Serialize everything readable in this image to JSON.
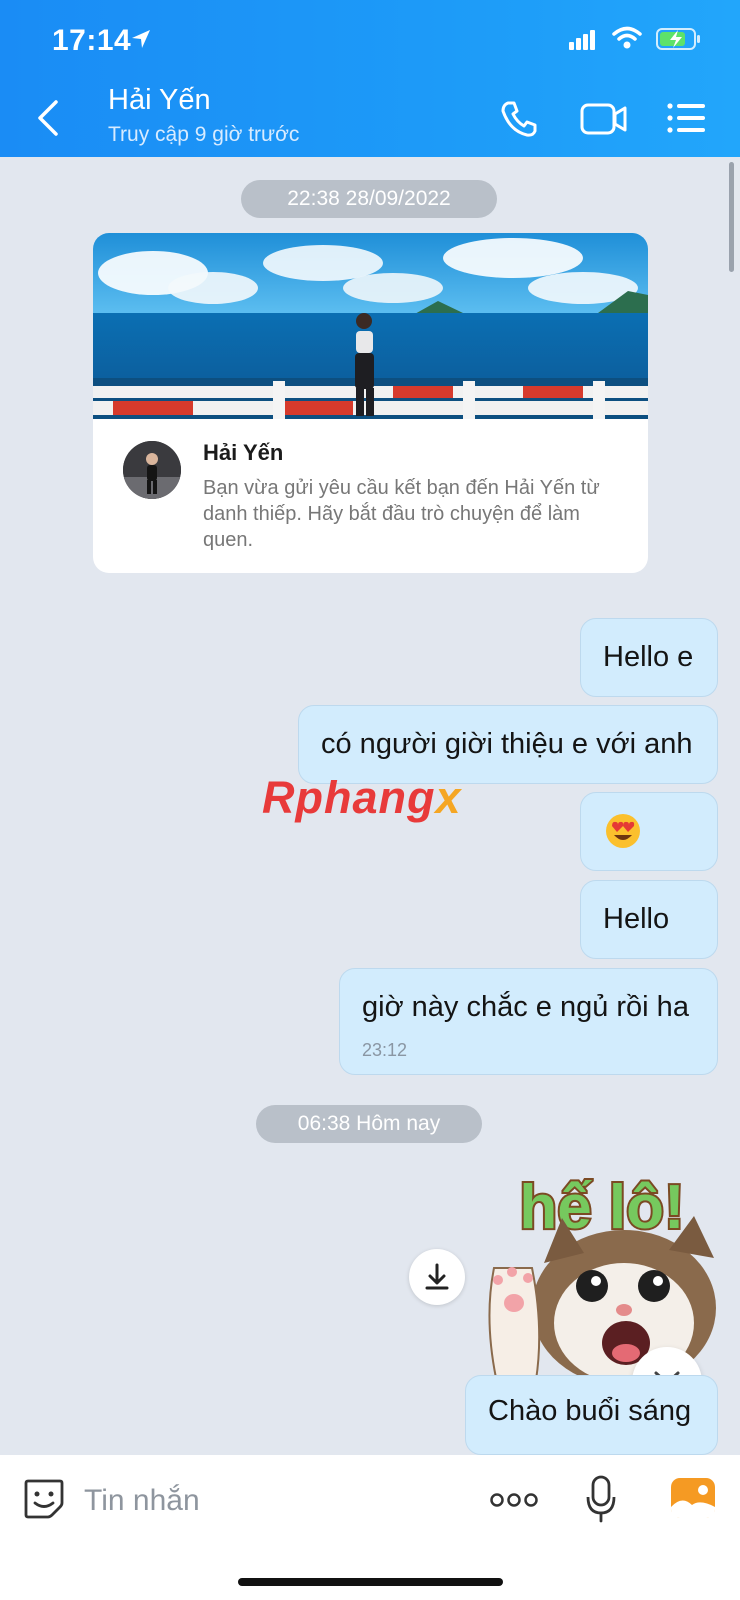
{
  "status_bar": {
    "time": "17:14"
  },
  "header": {
    "contact_name": "Hải Yến",
    "contact_status": "Truy cập 9 giờ trước",
    "icons": [
      "back-icon",
      "call-icon",
      "video-call-icon",
      "menu-icon"
    ]
  },
  "chat": {
    "date_divider_1": "22:38 28/09/2022",
    "friend_card": {
      "name": "Hải Yến",
      "text": "Bạn vừa gửi yêu cầu kết bạn đến Hải Yến từ danh thiếp. Hãy bắt đầu trò chuyện để làm quen."
    },
    "messages": [
      {
        "text": "Hello e"
      },
      {
        "text": "có người giời thiệu e với anh"
      },
      {
        "emoji": "heart-eyes"
      },
      {
        "text": "Hello"
      },
      {
        "text": "giờ này chắc e ngủ rồi ha",
        "time": "23:12"
      }
    ],
    "date_divider_2": "06:38 Hôm nay",
    "sticker": {
      "text": "hế lô!"
    },
    "last_message": "Chào buổi sáng"
  },
  "watermark": {
    "part1": "Rphang",
    "part2": "x"
  },
  "input": {
    "placeholder": "Tin nhắn"
  },
  "colors": {
    "header": "#1d9bf8",
    "bubble": "#d2ecfd",
    "background": "#e2e7ef",
    "accent_orange": "#f59a23"
  }
}
